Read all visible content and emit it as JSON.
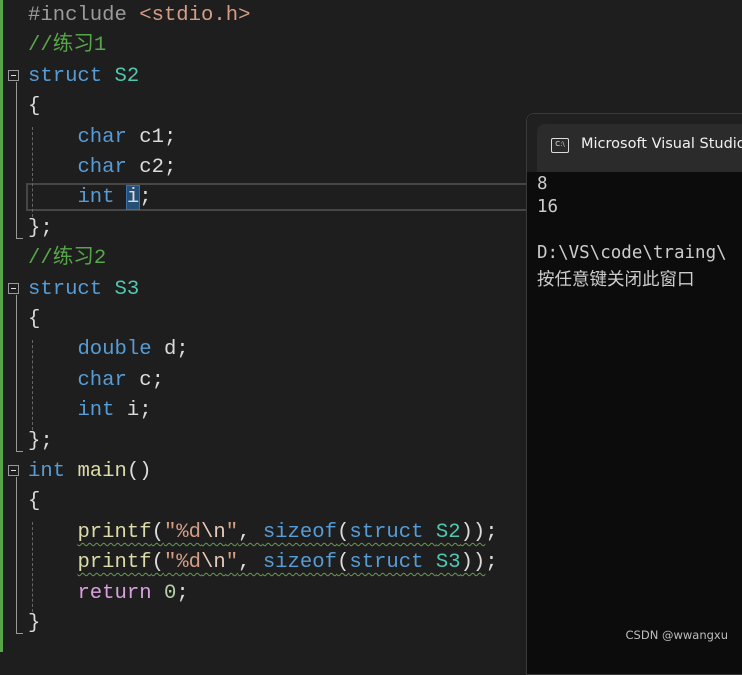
{
  "editor": {
    "lines": [
      [
        [
          "#include ",
          "pp"
        ],
        [
          "<stdio.h>",
          "inc"
        ]
      ],
      [
        [
          "//练习1",
          "cm"
        ]
      ],
      [
        [
          "struct ",
          "kw"
        ],
        [
          "S2",
          "ty"
        ]
      ],
      [
        [
          "{",
          "pl"
        ]
      ],
      [
        [
          "    ",
          "pl"
        ],
        [
          "char ",
          "kw"
        ],
        [
          "c1;",
          "pl"
        ]
      ],
      [
        [
          "    ",
          "pl"
        ],
        [
          "char ",
          "kw"
        ],
        [
          "c2;",
          "pl"
        ]
      ],
      [
        [
          "    ",
          "pl"
        ],
        [
          "int ",
          "kw"
        ],
        [
          "i",
          "pl sel"
        ],
        [
          ";",
          "pl"
        ]
      ],
      [
        [
          "};",
          "pl"
        ]
      ],
      [
        [
          "//练习2",
          "cm"
        ]
      ],
      [
        [
          "struct ",
          "kw"
        ],
        [
          "S3",
          "ty"
        ]
      ],
      [
        [
          "{",
          "pl"
        ]
      ],
      [
        [
          "    ",
          "pl"
        ],
        [
          "double ",
          "kw"
        ],
        [
          "d;",
          "pl"
        ]
      ],
      [
        [
          "    ",
          "pl"
        ],
        [
          "char ",
          "kw"
        ],
        [
          "c;",
          "pl"
        ]
      ],
      [
        [
          "    ",
          "pl"
        ],
        [
          "int ",
          "kw"
        ],
        [
          "i;",
          "pl"
        ]
      ],
      [
        [
          "};",
          "pl"
        ]
      ],
      [
        [
          "int ",
          "kw"
        ],
        [
          "main",
          "fn"
        ],
        [
          "()",
          "pl"
        ]
      ],
      [
        [
          "{",
          "pl"
        ]
      ],
      [
        [
          "    ",
          "pl"
        ],
        [
          "printf",
          "fn squig"
        ],
        [
          "(",
          "pl squig"
        ],
        [
          "\"%d",
          "st squig"
        ],
        [
          "\\n",
          "esc squig"
        ],
        [
          "\"",
          "st squig"
        ],
        [
          ", ",
          "pl squig"
        ],
        [
          "sizeof",
          "kw squig"
        ],
        [
          "(",
          "pl squig"
        ],
        [
          "struct ",
          "kw squig"
        ],
        [
          "S2",
          "ty squig"
        ],
        [
          "))",
          "pl squig"
        ],
        [
          ";",
          "pl"
        ]
      ],
      [
        [
          "    ",
          "pl"
        ],
        [
          "printf",
          "fn squig"
        ],
        [
          "(",
          "pl squig"
        ],
        [
          "\"%d",
          "st squig"
        ],
        [
          "\\n",
          "esc squig"
        ],
        [
          "\"",
          "st squig"
        ],
        [
          ", ",
          "pl squig"
        ],
        [
          "sizeof",
          "kw squig"
        ],
        [
          "(",
          "pl squig"
        ],
        [
          "struct ",
          "kw squig"
        ],
        [
          "S3",
          "ty squig"
        ],
        [
          "))",
          "pl squig"
        ],
        [
          ";",
          "pl"
        ]
      ],
      [
        [
          "    ",
          "pl"
        ],
        [
          "return ",
          "ctl"
        ],
        [
          "0",
          "num"
        ],
        [
          ";",
          "pl"
        ]
      ],
      [
        [
          "}",
          "pl"
        ]
      ]
    ]
  },
  "console": {
    "title": "Microsoft Visual Studio",
    "icon": "console-icon",
    "icon_text": "C:\\",
    "output": [
      "8",
      "16",
      "",
      "D:\\VS\\code\\traing\\",
      "按任意键关闭此窗口"
    ]
  },
  "watermark": "CSDN @wwangxu",
  "colors": {
    "background": "#1e1e1e",
    "keyword": "#569cd6",
    "type": "#4ec9b0",
    "comment": "#57a64a",
    "string": "#d69d85",
    "function": "#dcdcaa"
  }
}
